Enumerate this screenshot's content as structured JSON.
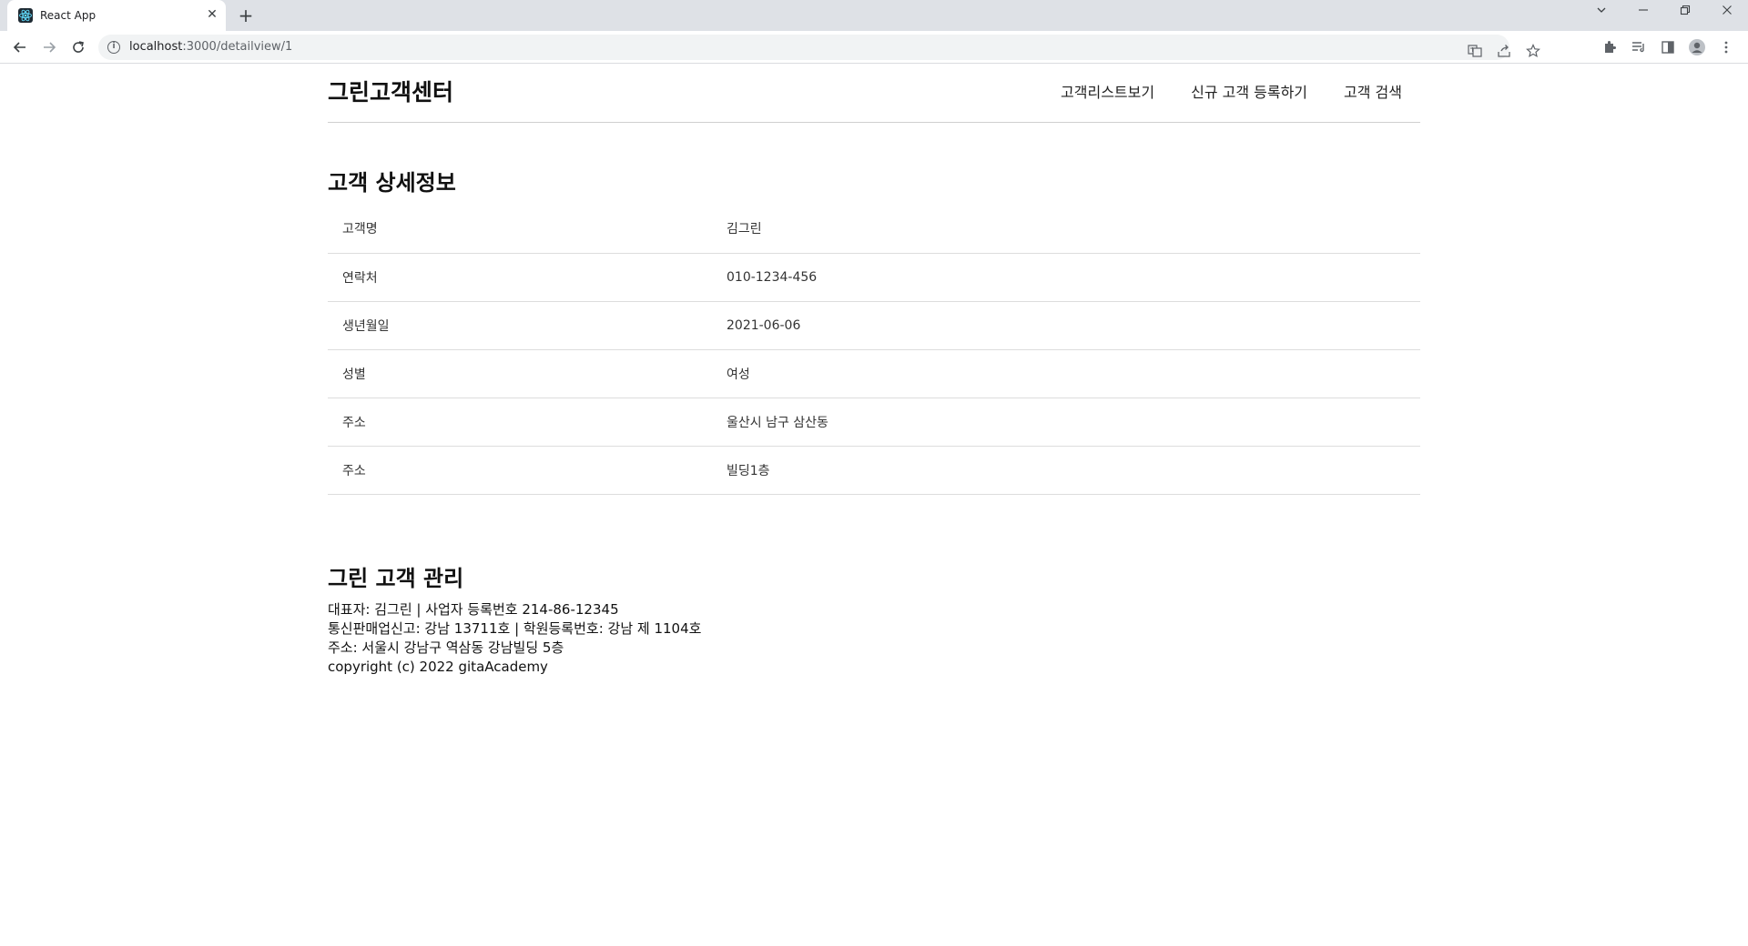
{
  "browser": {
    "tab_title": "React App",
    "tab_close": "✕",
    "new_tab": "+",
    "url_host": "localhost",
    "url_path": ":3000/detailview/1"
  },
  "header": {
    "brand": "그린고객센터",
    "menu": [
      "고객리스트보기",
      "신규 고객 등록하기",
      "고객 검색"
    ]
  },
  "detail": {
    "title": "고객 상세정보",
    "rows": [
      {
        "label": "고객명",
        "value": "김그린"
      },
      {
        "label": "연락처",
        "value": "010-1234-456"
      },
      {
        "label": "생년월일",
        "value": "2021-06-06"
      },
      {
        "label": "성별",
        "value": "여성"
      },
      {
        "label": "주소",
        "value": "울산시 남구 삼산동"
      },
      {
        "label": "주소",
        "value": "빌딩1층"
      }
    ]
  },
  "footer": {
    "title": "그린 고객 관리",
    "lines": [
      "대표자: 김그린 | 사업자 등록번호 214-86-12345",
      "통신판매업신고: 강남 13711호 | 학원등록번호: 강남 제 1104호",
      "주소: 서울시 강남구 역삼동 강남빌딩 5층",
      "copyright (c) 2022 gitaAcademy"
    ]
  },
  "icons": {
    "favicon": "react-icon",
    "back": "arrow-left-icon",
    "forward": "arrow-right-icon",
    "reload": "reload-icon",
    "site_info": "info-icon",
    "translate": "translate-icon",
    "share": "share-icon",
    "bookmark": "star-icon",
    "extensions": "puzzle-icon",
    "reading_list": "reading-list-icon",
    "side_panel": "side-panel-icon",
    "profile": "profile-icon",
    "menu": "kebab-menu-icon"
  }
}
